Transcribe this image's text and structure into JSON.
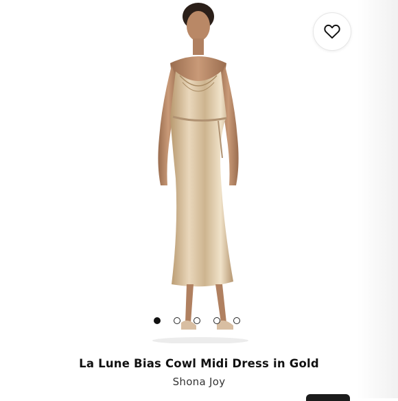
{
  "product": {
    "title": "La Lune Bias Cowl Midi Dress in Gold",
    "brand": "Shona Joy"
  },
  "gallery": {
    "image_count": 5,
    "active_index": 0
  },
  "icons": {
    "favorite": "heart-outline-icon"
  },
  "colors": {
    "dress": "#cdb48f",
    "dot_active": "#111111",
    "text": "#111111"
  }
}
